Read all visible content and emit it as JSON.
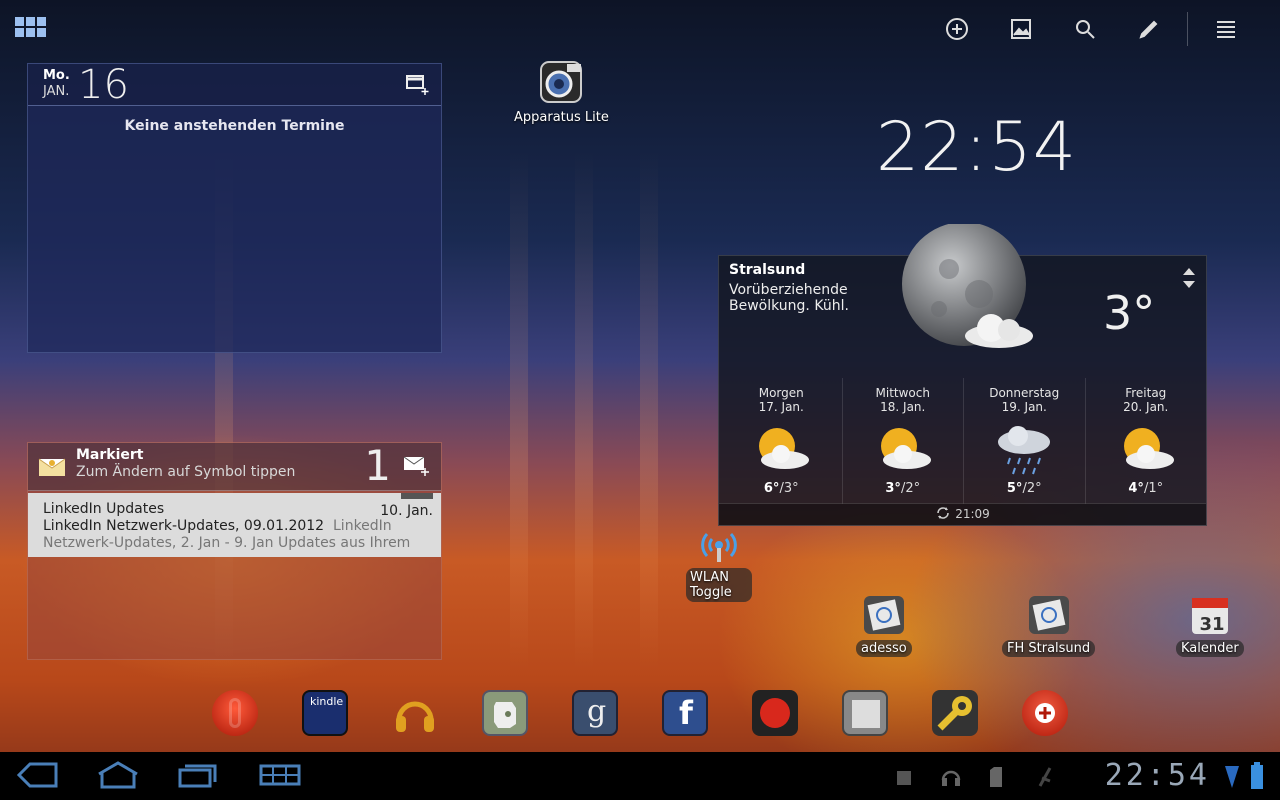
{
  "top_bar": {
    "actions": [
      {
        "name": "add-icon"
      },
      {
        "name": "wallpaper-icon"
      },
      {
        "name": "search-icon"
      },
      {
        "name": "edit-icon"
      }
    ]
  },
  "calendar_widget": {
    "day_of_week": "Mo.",
    "month": "JAN.",
    "day": "16",
    "empty_text": "Keine anstehenden Termine"
  },
  "apparatus": {
    "label": "Apparatus Lite"
  },
  "clock": {
    "time": "22:54"
  },
  "weather": {
    "city": "Stralsund",
    "condition": "Vorüberziehende Bewölkung. Kühl.",
    "temperature": "3°",
    "forecast": [
      {
        "day": "Morgen",
        "date": "17. Jan.",
        "high": "6°",
        "low": "/3°",
        "icon": "partly-sunny-icon"
      },
      {
        "day": "Mittwoch",
        "date": "18. Jan.",
        "high": "3°",
        "low": "/2°",
        "icon": "partly-sunny-icon"
      },
      {
        "day": "Donnerstag",
        "date": "19. Jan.",
        "high": "5°",
        "low": "/2°",
        "icon": "rain-icon"
      },
      {
        "day": "Freitag",
        "date": "20. Jan.",
        "high": "4°",
        "low": "/1°",
        "icon": "partly-sunny-icon"
      }
    ],
    "updated": "21:09"
  },
  "mail_widget": {
    "folder": "Markiert",
    "hint": "Zum Ändern auf Symbol tippen",
    "count": "1",
    "item": {
      "from": "LinkedIn Updates",
      "date": "10. Jan.",
      "subject": "LinkedIn Netzwerk-Updates, 09.01.2012",
      "snippet_a": "LinkedIn",
      "snippet_b": "Netzwerk-Updates, 2. Jan - 9. Jan Updates aus Ihrem"
    }
  },
  "shortcuts": {
    "wlan": "WLAN Toggle",
    "adesso": "adesso",
    "fh": "FH Stralsund",
    "kalender": "Kalender"
  },
  "dock": [
    {
      "name": "opera-icon",
      "color": "#d8321c"
    },
    {
      "name": "kindle-icon",
      "color": "#1a2e6e",
      "label": "kindle"
    },
    {
      "name": "music-icon",
      "color": "#e0a020"
    },
    {
      "name": "evernote-icon",
      "color": "#6a7a5a"
    },
    {
      "name": "google-icon",
      "color": "#3a4e6e"
    },
    {
      "name": "facebook-icon",
      "color": "#2e4e8e"
    },
    {
      "name": "angry-birds-icon",
      "color": "#222222"
    },
    {
      "name": "news-icon",
      "color": "#777777"
    },
    {
      "name": "settings-icon",
      "color": "#e6c030"
    },
    {
      "name": "add-app-icon",
      "color": "#d83c24"
    }
  ],
  "status_bar": {
    "time": "22:54"
  }
}
